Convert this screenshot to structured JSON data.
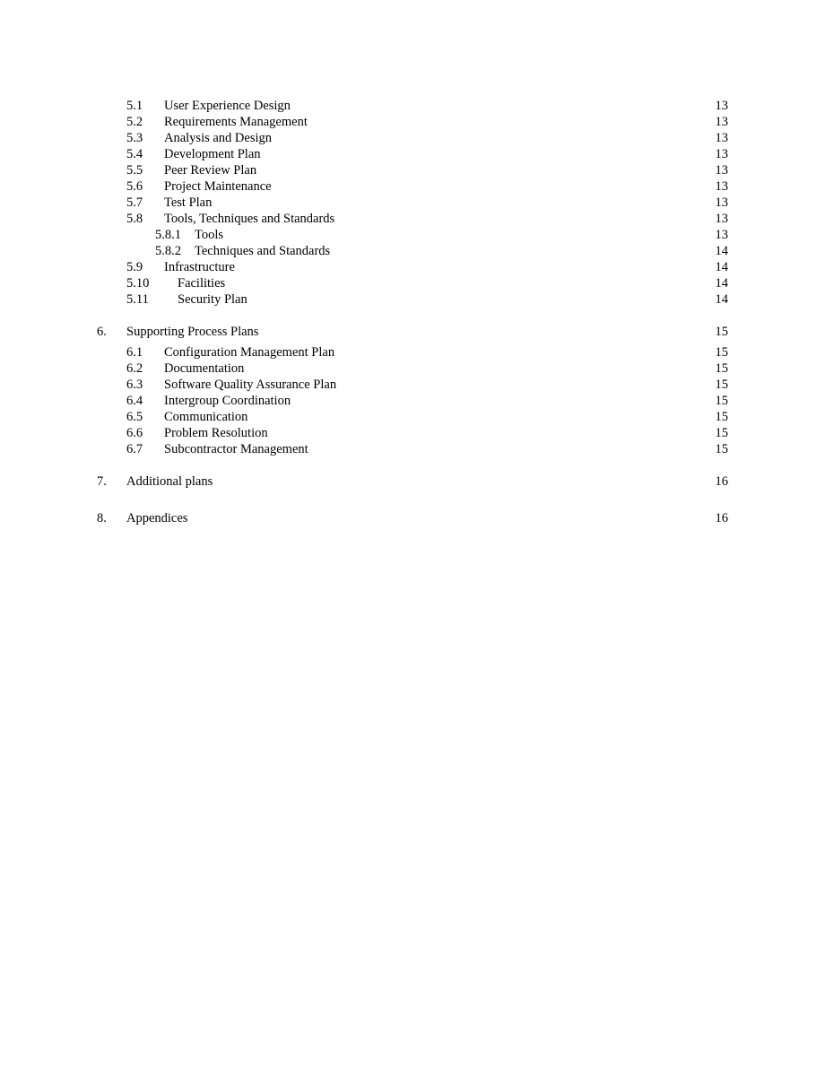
{
  "toc": [
    {
      "level": 2,
      "number": "5.1",
      "title": "User Experience Design",
      "page": "13"
    },
    {
      "level": 2,
      "number": "5.2",
      "title": "Requirements Management",
      "page": "13"
    },
    {
      "level": 2,
      "number": "5.3",
      "title": "Analysis and Design",
      "page": "13"
    },
    {
      "level": 2,
      "number": "5.4",
      "title": "Development Plan",
      "page": "13"
    },
    {
      "level": 2,
      "number": "5.5",
      "title": "Peer Review Plan",
      "page": "13"
    },
    {
      "level": 2,
      "number": "5.6",
      "title": "Project Maintenance",
      "page": "13"
    },
    {
      "level": 2,
      "number": "5.7",
      "title": "Test Plan",
      "page": "13"
    },
    {
      "level": 2,
      "number": "5.8",
      "title": "Tools, Techniques and Standards",
      "page": "13"
    },
    {
      "level": 3,
      "number": "5.8.1",
      "title": "Tools",
      "page": "13"
    },
    {
      "level": 3,
      "number": "5.8.2",
      "title": "Techniques and Standards",
      "page": "14"
    },
    {
      "level": 2,
      "number": "5.9",
      "title": "Infrastructure",
      "page": "14"
    },
    {
      "level": 2,
      "number": "5.10",
      "title": "Facilities",
      "page": "14"
    },
    {
      "level": 2,
      "number": "5.11",
      "title": "Security Plan",
      "page": "14"
    },
    {
      "level": 1,
      "number": "6.",
      "title": "Supporting Process Plans",
      "page": "15"
    },
    {
      "level": 2,
      "number": "6.1",
      "title": "Configuration Management Plan",
      "page": "15"
    },
    {
      "level": 2,
      "number": "6.2",
      "title": "Documentation",
      "page": "15"
    },
    {
      "level": 2,
      "number": "6.3",
      "title": "Software Quality Assurance Plan",
      "page": "15"
    },
    {
      "level": 2,
      "number": "6.4",
      "title": "Intergroup Coordination",
      "page": "15"
    },
    {
      "level": 2,
      "number": "6.5",
      "title": "Communication",
      "page": "15"
    },
    {
      "level": 2,
      "number": "6.6",
      "title": "Problem Resolution",
      "page": "15"
    },
    {
      "level": 2,
      "number": "6.7",
      "title": "Subcontractor Management",
      "page": "15"
    },
    {
      "level": 1,
      "number": "7.",
      "title": "Additional plans",
      "page": "16"
    },
    {
      "level": 1,
      "number": "8.",
      "title": "Appendices",
      "page": "16"
    }
  ]
}
